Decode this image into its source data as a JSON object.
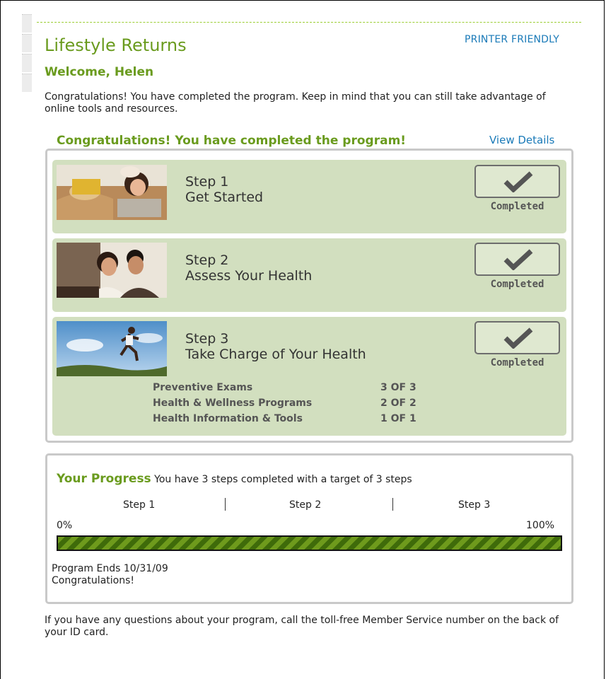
{
  "header": {
    "printer_friendly": "PRINTER FRIENDLY",
    "title": "Lifestyle Returns",
    "welcome": "Welcome, Helen",
    "intro": "Congratulations! You have completed the program. Keep in mind that you can still take advantage of online tools and resources."
  },
  "program": {
    "heading": "Congratulations! You have completed the program!",
    "view_details": "View Details",
    "steps": [
      {
        "number": "Step 1",
        "name": "Get Started",
        "status": "Completed",
        "image": "family-with-dog-photo"
      },
      {
        "number": "Step 2",
        "name": "Assess Your Health",
        "status": "Completed",
        "image": "couple-at-laptop-photo"
      },
      {
        "number": "Step 3",
        "name": "Take Charge of Your Health",
        "status": "Completed",
        "image": "man-running-photo",
        "items": [
          {
            "label": "Preventive Exams",
            "value": "3 OF 3"
          },
          {
            "label": "Health & Wellness Programs",
            "value": "2 OF 2"
          },
          {
            "label": "Health Information & Tools",
            "value": "1 OF 1"
          }
        ]
      }
    ]
  },
  "progress": {
    "title": "Your Progress",
    "summary": "You have 3 steps completed with a target of 3 steps",
    "markers": [
      "Step 1",
      "Step 2",
      "Step 3"
    ],
    "start_label": "0%",
    "end_label": "100%",
    "fraction": 1.0,
    "program_ends": "Program Ends 10/31/09",
    "message": "Congratulations!"
  },
  "footer": {
    "text": "If you have any questions about your program, call the toll-free Member Service number on the back of your ID card."
  },
  "colors": {
    "accent_green": "#6a9b1e",
    "link_blue": "#1a7ab8",
    "step_background": "#d2dfbf",
    "bar_green": "#6e9a1c"
  },
  "icons": {
    "completed": "checkmark-icon"
  }
}
